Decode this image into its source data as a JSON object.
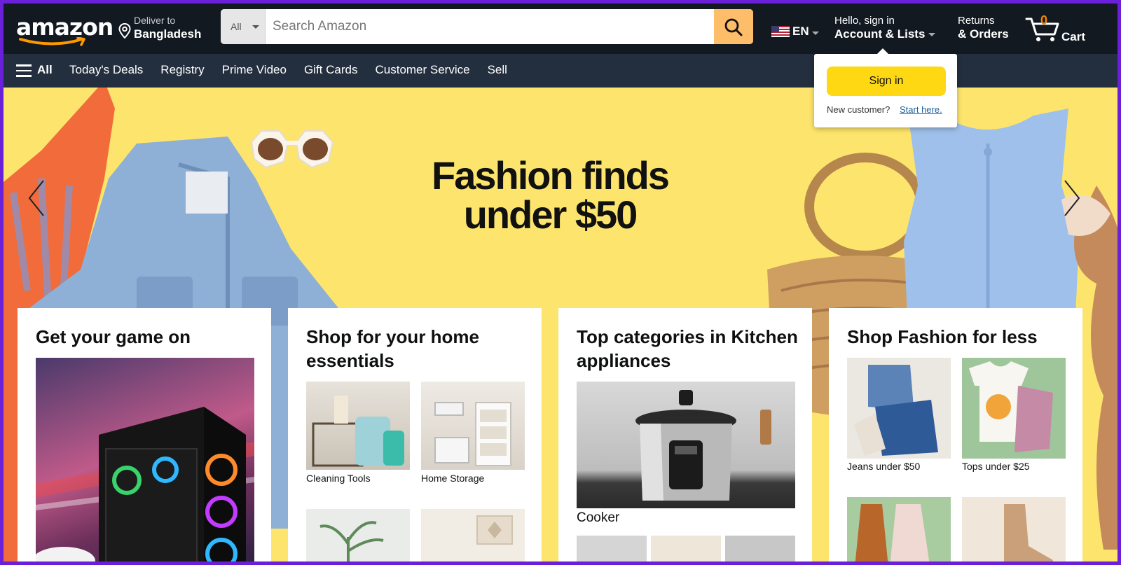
{
  "header": {
    "logo": "amazon",
    "deliver_label": "Deliver to",
    "deliver_location": "Bangladesh",
    "search": {
      "category": "All",
      "placeholder": "Search Amazon"
    },
    "language": "EN",
    "account_greeting": "Hello, sign in",
    "account_label": "Account & Lists",
    "returns_label": "Returns",
    "orders_label": "& Orders",
    "cart_count": "0",
    "cart_label": "Cart"
  },
  "nav": {
    "all_label": "All",
    "links": [
      "Today's Deals",
      "Registry",
      "Prime Video",
      "Gift Cards",
      "Customer Service",
      "Sell"
    ]
  },
  "hero": {
    "title_line1": "Fashion finds",
    "title_line2": "under $50"
  },
  "signin_popover": {
    "button": "Sign in",
    "new_customer": "New customer?",
    "start_here": "Start here."
  },
  "cards": [
    {
      "title": "Get your game on"
    },
    {
      "title": "Shop for your home essentials",
      "items": [
        "Cleaning Tools",
        "Home Storage"
      ]
    },
    {
      "title": "Top categories in Kitchen appliances",
      "items": [
        "Cooker"
      ]
    },
    {
      "title": "Shop Fashion for less",
      "items": [
        "Jeans under $50",
        "Tops under $25"
      ]
    }
  ],
  "colors": {
    "header_bg": "#131921",
    "nav_bg": "#232f3e",
    "hero_bg": "#fde56d",
    "search_button": "#febd69",
    "signin_button": "#ffd814",
    "cart_count": "#f08804",
    "link": "#2162a1"
  }
}
